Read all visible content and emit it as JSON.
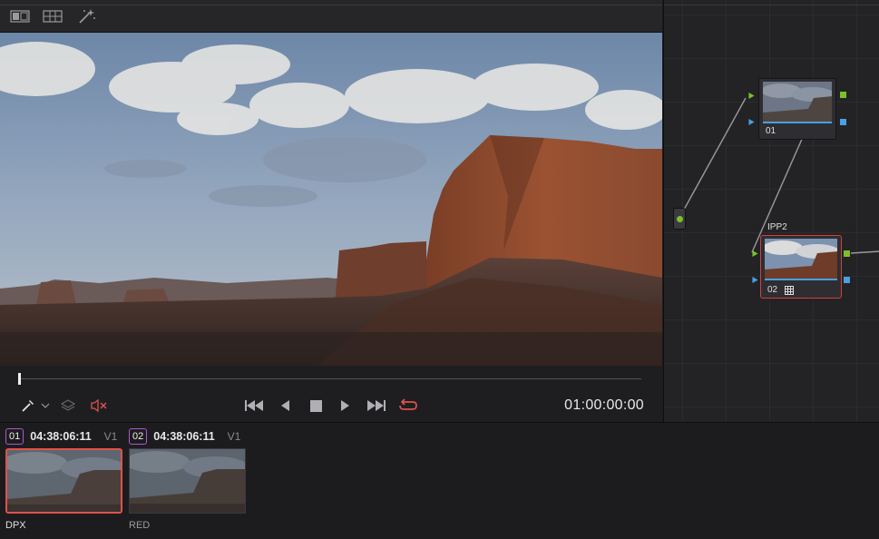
{
  "viewer": {
    "toolbar": {
      "icons": [
        "image-wipe-icon",
        "split-screen-icon",
        "magic-wand-icon"
      ]
    },
    "timecode": "01:00:00:00",
    "playhead": 0.0
  },
  "transport": {
    "icons": [
      "eyedropper-icon",
      "chevron-down-icon",
      "layers-icon",
      "mute-icon",
      "skip-to-start-icon",
      "play-reverse-icon",
      "stop-icon",
      "play-icon",
      "skip-to-end-icon",
      "loop-icon"
    ],
    "accent_red": "#e0524a"
  },
  "node_editor": {
    "nodes": [
      {
        "label": "01",
        "title": ""
      },
      {
        "label": "02",
        "title": "IPP2"
      }
    ],
    "colors": {
      "input_port": "#7bc02a",
      "output_port": "#4aa0e0",
      "selected_border": "#d2403a"
    }
  },
  "clips": [
    {
      "number": "01",
      "timecode": "04:38:06:11",
      "track": "V1",
      "name": "DPX"
    },
    {
      "number": "02",
      "timecode": "04:38:06:11",
      "track": "V1",
      "name": "RED"
    }
  ]
}
